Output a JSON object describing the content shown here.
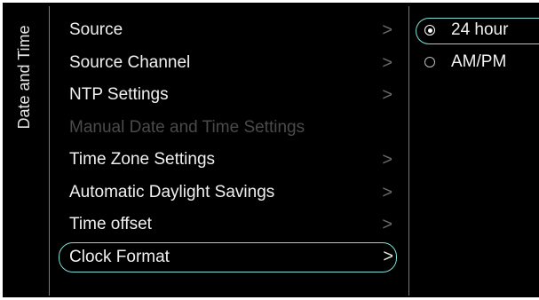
{
  "section": {
    "title": "Date and Time"
  },
  "menu": {
    "items": [
      {
        "label": "Source",
        "state": "normal"
      },
      {
        "label": "Source Channel",
        "state": "normal"
      },
      {
        "label": "NTP Settings",
        "state": "normal"
      },
      {
        "label": "Manual Date and Time Settings",
        "state": "disabled"
      },
      {
        "label": "Time Zone Settings",
        "state": "normal"
      },
      {
        "label": "Automatic Daylight Savings",
        "state": "normal"
      },
      {
        "label": "Time offset",
        "state": "normal"
      },
      {
        "label": "Clock Format",
        "state": "selected"
      }
    ],
    "chevron_glyph": ">"
  },
  "options": {
    "items": [
      {
        "label": "24 hour",
        "checked": true
      },
      {
        "label": "AM/PM",
        "checked": false
      }
    ]
  },
  "colors": {
    "background": "#000000",
    "text": "#f0f0f0",
    "disabled_text": "#4a4a4a",
    "focus_outline": "#7ee0d8",
    "chevron": "#6c6c6c"
  },
  "icons": {
    "chevron": "chevron-right-icon",
    "radio_checked": "radio-checked-icon",
    "radio_unchecked": "radio-unchecked-icon"
  }
}
